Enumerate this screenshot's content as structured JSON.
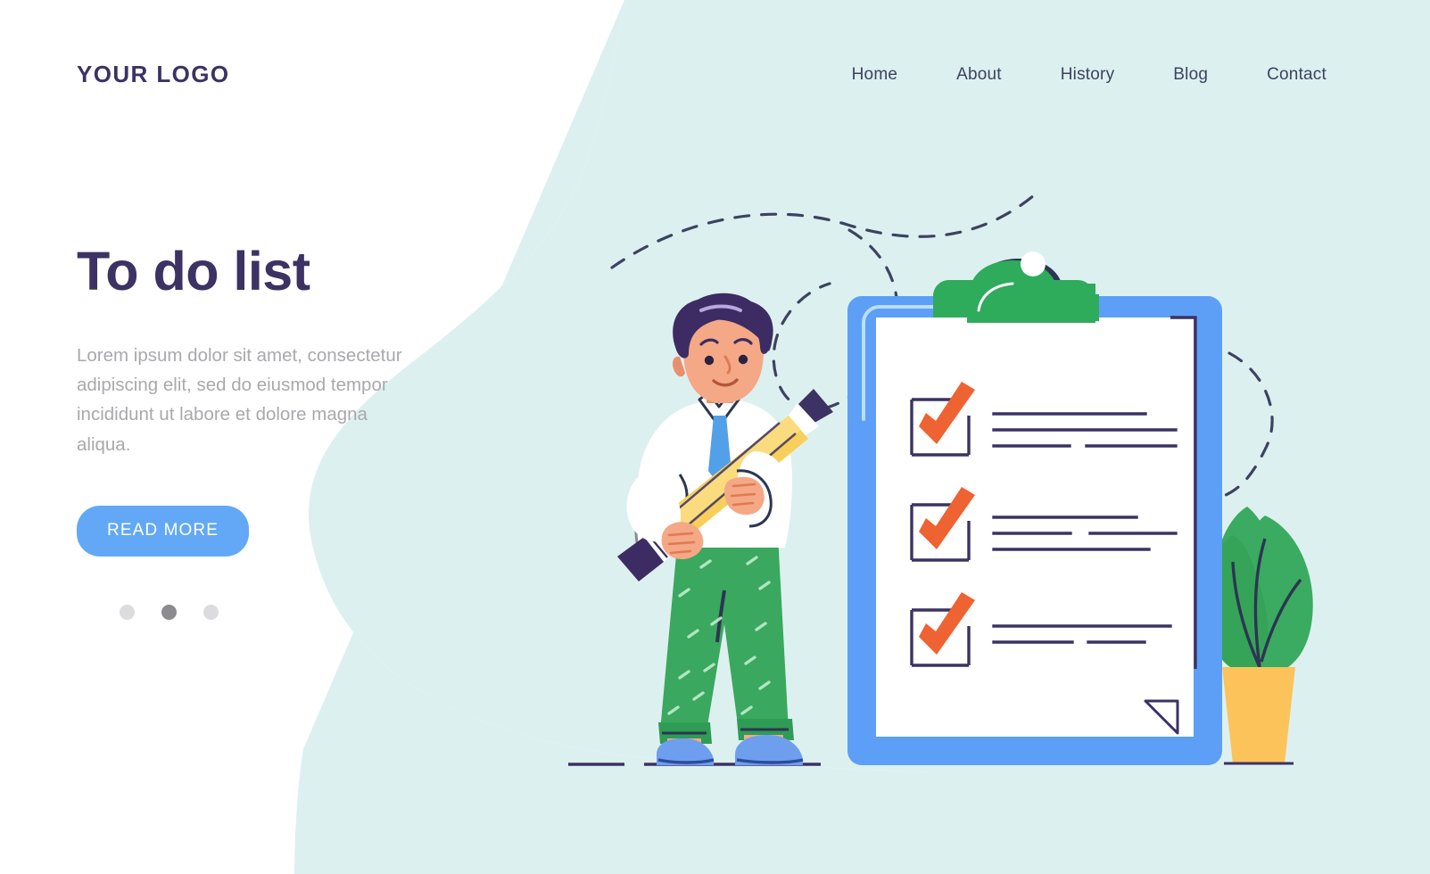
{
  "header": {
    "logo": "YOUR LOGO",
    "nav": [
      {
        "label": "Home"
      },
      {
        "label": "About"
      },
      {
        "label": "History"
      },
      {
        "label": "Blog"
      },
      {
        "label": "Contact"
      }
    ]
  },
  "hero": {
    "title": "To do list",
    "subtitle": "Lorem ipsum dolor sit amet, consectetur adipiscing elit, sed do eiusmod tempor incididunt ut labore et dolore magna aliqua.",
    "cta_label": "READ MORE",
    "carousel_dots": [
      {
        "active": false
      },
      {
        "active": true
      },
      {
        "active": false
      }
    ]
  },
  "illustration": {
    "name": "man-with-pencil-and-checklist-clipboard",
    "clipboard": {
      "clip_color": "#2eab5b",
      "board_color": "#5d9ff6",
      "paper_color": "#ffffff",
      "items": [
        {
          "checked": true,
          "lines": 3
        },
        {
          "checked": true,
          "lines": 3
        },
        {
          "checked": true,
          "lines": 2
        }
      ]
    },
    "character": {
      "hair_color": "#3c2c63",
      "skin_color": "#f4a886",
      "shirt_color": "#ffffff",
      "tie_color": "#52a0e8",
      "pants_color": "#3aa85e",
      "shoe_color": "#6e9eee"
    },
    "pencil": {
      "body_color": "#f7cf5a",
      "tip_color": "#3c3263",
      "eraser_color": "#3c3263"
    },
    "plant": {
      "leaf_color": "#3aab60",
      "pot_color": "#fbc35a"
    }
  },
  "colors": {
    "background": "#ffffff",
    "blob": "#ddf0f0",
    "accent_blue": "#62a8f7",
    "navy": "#3c3263",
    "orange_check": "#ef6232",
    "green": "#2eab5b",
    "muted_text": "#a9a9ad"
  }
}
